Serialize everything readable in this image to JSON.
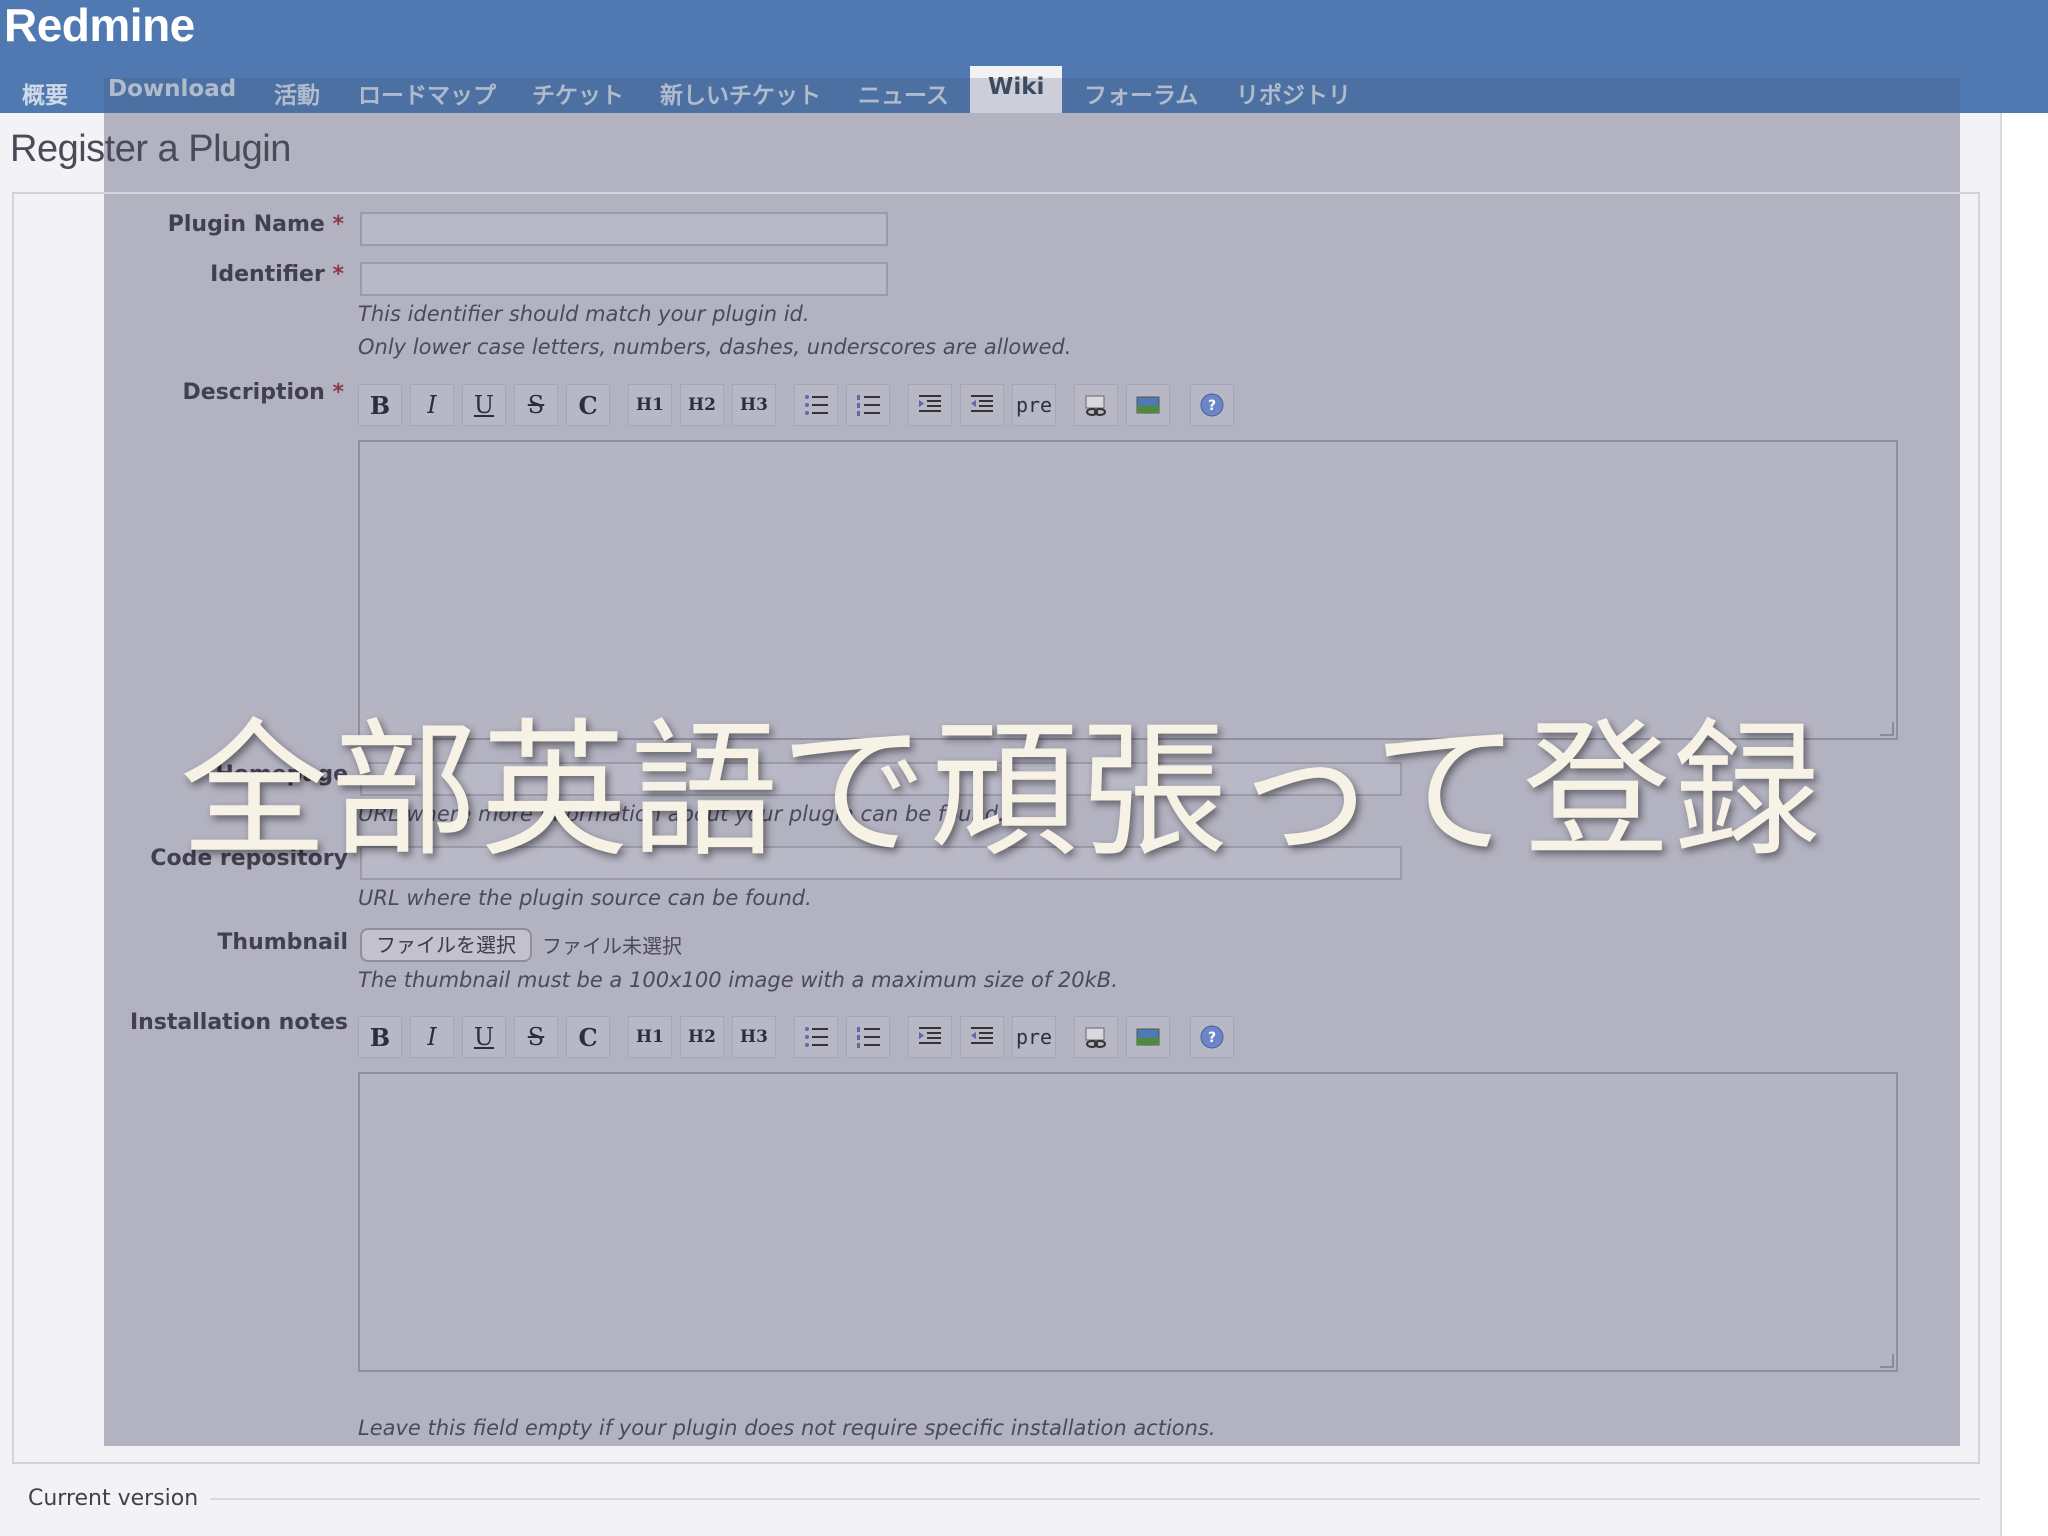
{
  "app": {
    "title": "Redmine"
  },
  "menu": [
    {
      "label": "概要"
    },
    {
      "label": "Download"
    },
    {
      "label": "活動"
    },
    {
      "label": "ロードマップ"
    },
    {
      "label": "チケット"
    },
    {
      "label": "新しいチケット"
    },
    {
      "label": "ニュース"
    },
    {
      "label": "Wiki"
    },
    {
      "label": "フォーラム"
    },
    {
      "label": "リポジトリ"
    }
  ],
  "page": {
    "title": "Register a Plugin"
  },
  "form": {
    "required_mark": "*",
    "plugin_name": {
      "label": "Plugin Name",
      "value": ""
    },
    "identifier": {
      "label": "Identifier",
      "value": "",
      "hint1": "This identifier should match your plugin id.",
      "hint2": "Only lower case letters, numbers, dashes, underscores are allowed."
    },
    "description": {
      "label": "Description",
      "value": ""
    },
    "homepage": {
      "label": "Homepage",
      "value": "",
      "hint": "URL where more information about your plugin can be found."
    },
    "code_repository": {
      "label": "Code repository",
      "value": "",
      "hint": "URL where the plugin source can be found."
    },
    "thumbnail": {
      "label": "Thumbnail",
      "button": "ファイルを選択",
      "status": "ファイル未選択",
      "hint": "The thumbnail must be a 100x100 image with a maximum size of 20kB."
    },
    "installation_notes": {
      "label": "Installation notes",
      "value": "",
      "hint": "Leave this field empty if your plugin does not require specific installation actions."
    },
    "current_version": {
      "label": "Current version"
    }
  },
  "toolbar": {
    "bold": "B",
    "italic": "I",
    "underline": "U",
    "strike": "S",
    "code": "C",
    "h1": "H1",
    "h2": "H2",
    "h3": "H3",
    "pre": "pre"
  },
  "caption": {
    "text": "全部英語で頑張って登録"
  },
  "colors": {
    "header": "#4f79b0",
    "overlay": "#b3b2c0",
    "caption": "#f6f2e6"
  }
}
